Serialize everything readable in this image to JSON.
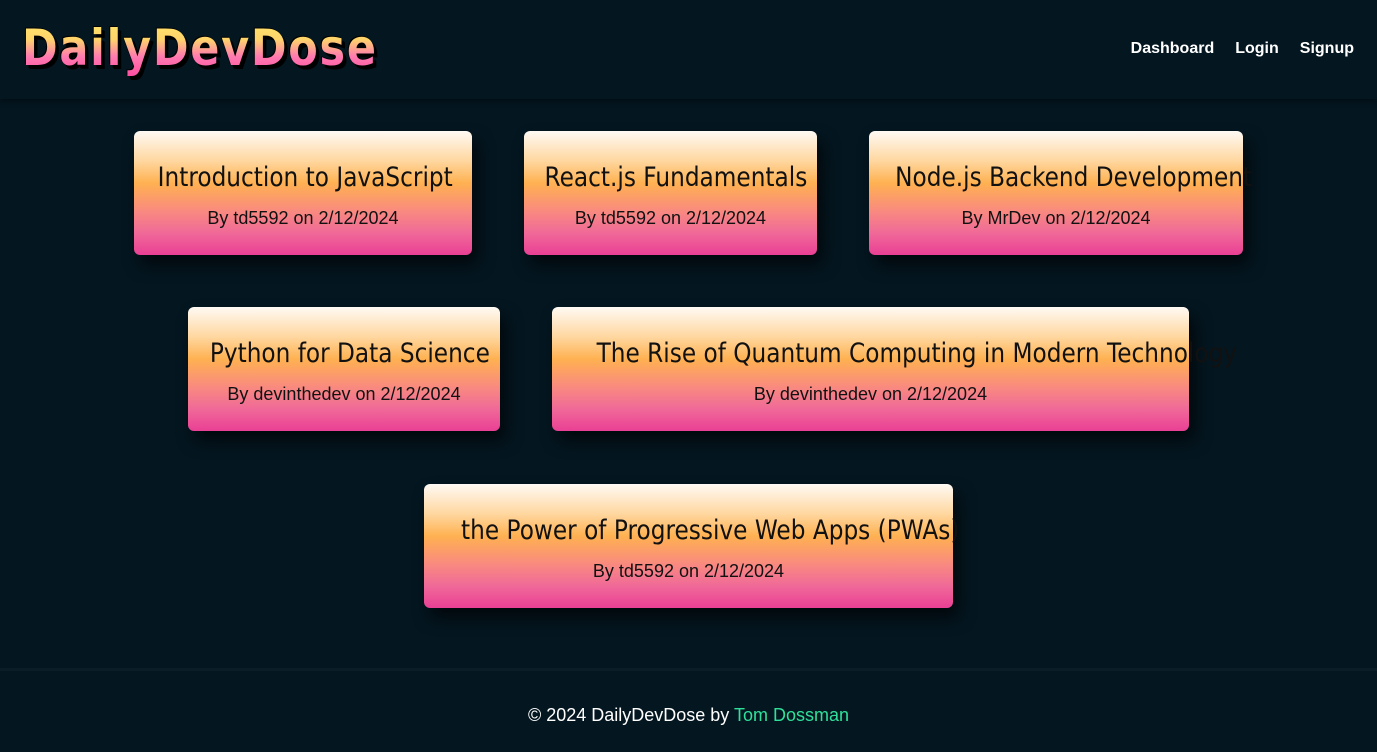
{
  "header": {
    "logo": "DailyDevDose",
    "nav": {
      "dashboard": "Dashboard",
      "login": "Login",
      "signup": "Signup"
    }
  },
  "posts": [
    {
      "title": "Introduction to JavaScript",
      "meta": "By td5592 on 2/12/2024"
    },
    {
      "title": "React.js Fundamentals",
      "meta": "By td5592 on 2/12/2024"
    },
    {
      "title": "Node.js Backend Development",
      "meta": "By MrDev on 2/12/2024"
    },
    {
      "title": "Python for Data Science",
      "meta": "By devinthedev on 2/12/2024"
    },
    {
      "title": "The Rise of Quantum Computing in Modern Technology",
      "meta": "By devinthedev on 2/12/2024"
    },
    {
      "title": "the Power of Progressive Web Apps (PWAs)",
      "meta": "By td5592 on 2/12/2024"
    }
  ],
  "footer": {
    "text": "© 2024 DailyDevDose by ",
    "author": "Tom Dossman"
  },
  "colors": {
    "background": "#041620",
    "footer_link": "#2fe09a"
  }
}
